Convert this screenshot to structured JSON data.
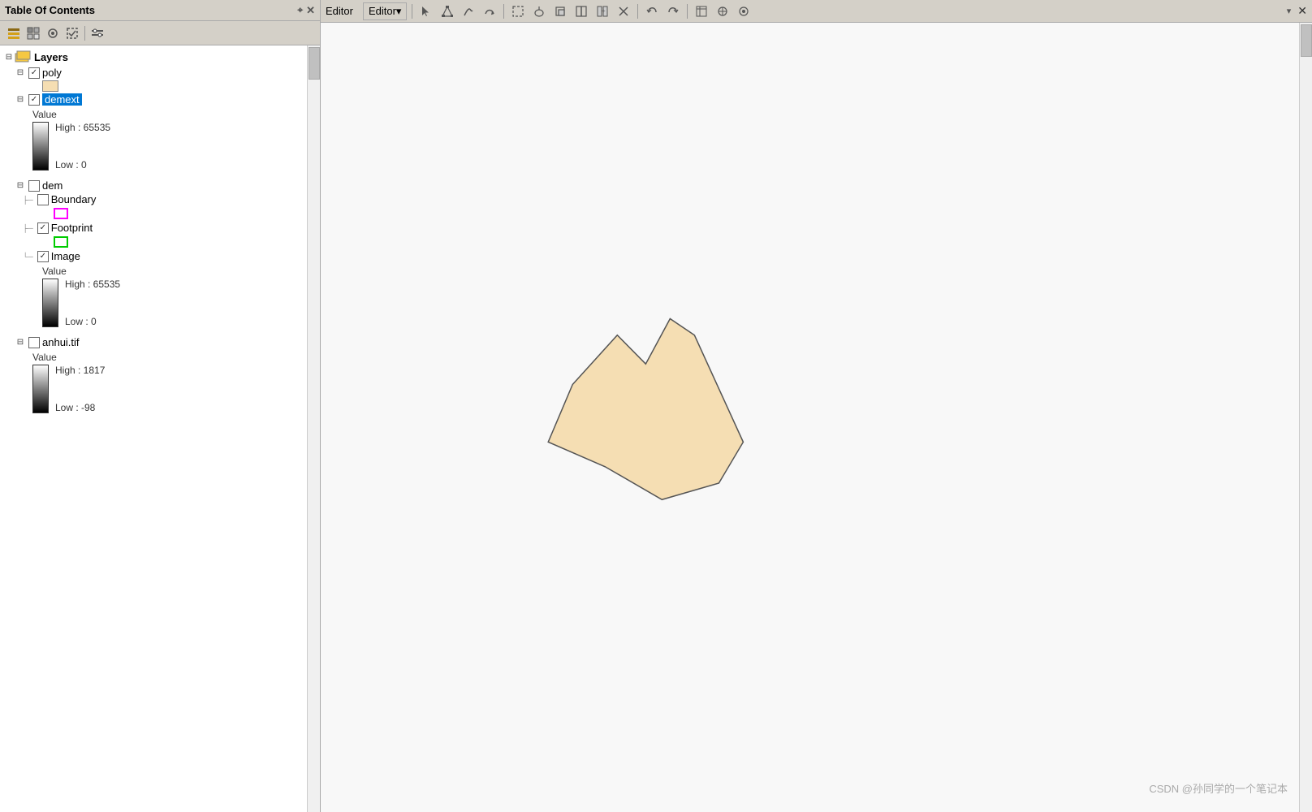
{
  "toc": {
    "title": "Table Of Contents",
    "toolbar_icons": [
      "list-view-icon",
      "table-icon",
      "layers-icon",
      "source-icon",
      "options-icon"
    ],
    "layers_label": "Layers",
    "layers": [
      {
        "id": "poly",
        "label": "poly",
        "checked": true,
        "type": "vector",
        "swatch": "tan",
        "indent": 1
      },
      {
        "id": "demext",
        "label": "demext",
        "checked": true,
        "selected": true,
        "type": "raster",
        "legend": {
          "value_label": "Value",
          "high_label": "High : 65535",
          "low_label": "Low : 0"
        },
        "indent": 1
      },
      {
        "id": "dem",
        "label": "dem",
        "checked": false,
        "type": "group",
        "indent": 1,
        "children": [
          {
            "id": "boundary",
            "label": "Boundary",
            "checked": false,
            "type": "vector",
            "swatch": "magenta",
            "indent": 2
          },
          {
            "id": "footprint",
            "label": "Footprint",
            "checked": true,
            "type": "vector",
            "swatch": "green",
            "indent": 2
          },
          {
            "id": "image",
            "label": "Image",
            "checked": true,
            "type": "raster",
            "legend": {
              "value_label": "Value",
              "high_label": "High : 65535",
              "low_label": "Low : 0"
            },
            "indent": 2
          }
        ]
      },
      {
        "id": "anhui-tif",
        "label": "anhui.tif",
        "checked": false,
        "type": "raster",
        "legend": {
          "value_label": "Value",
          "high_label": "High : 1817",
          "low_label": "Low : -98"
        },
        "indent": 1
      }
    ]
  },
  "editor": {
    "title": "Editor",
    "dropdown_label": "Editor▾",
    "tools": [
      "pointer-icon",
      "edit-vertices-icon",
      "sketch-icon",
      "reshape-icon",
      "select-rect-icon",
      "select-lasso-icon",
      "clip-icon",
      "split-icon",
      "merge-icon",
      "cut-icon",
      "undo-icon",
      "redo-icon",
      "attributes-icon",
      "snapping-icon",
      "options-icon"
    ],
    "close_label": "✕"
  },
  "map": {
    "shape_fill": "#f5deb3",
    "shape_stroke": "#555"
  },
  "watermark": "CSDN @孙同学的一个笔记本"
}
